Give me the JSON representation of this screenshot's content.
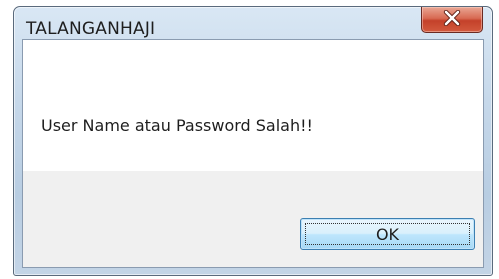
{
  "window": {
    "title": "TALANGANHAJI"
  },
  "dialog": {
    "message": "User Name atau Password Salah!!",
    "ok_label": "OK"
  },
  "icons": {
    "close": "close-icon"
  },
  "colors": {
    "frame": "#c6d8ea",
    "close_button": "#c4412a",
    "ok_border": "#3c7fb1",
    "footer": "#f0f0f0"
  }
}
